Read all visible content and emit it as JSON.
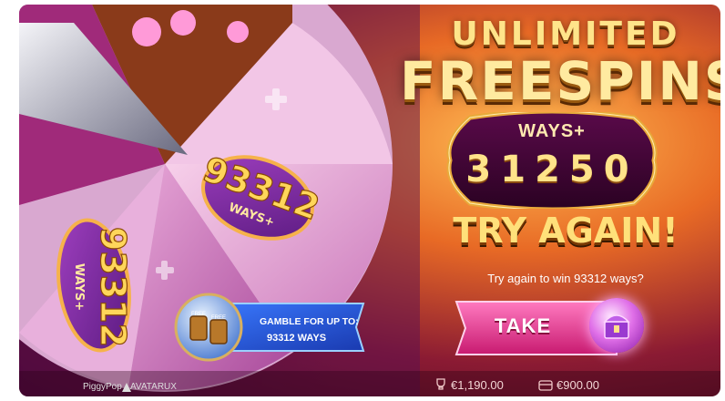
{
  "header": {
    "title_top": "UNLIMITED",
    "title_main": "FREESPINS"
  },
  "ways_panel": {
    "label": "WAYS+",
    "value": "31250"
  },
  "result": {
    "headline": "TRY AGAIN!",
    "message": "Try again to win 93312 ways?"
  },
  "wheel": {
    "slices": [
      {
        "ways": "93312",
        "label": "WAYS+"
      },
      {
        "ways": "93312",
        "label": "WAYS+"
      }
    ]
  },
  "gamble": {
    "line1": "GAMBLE FOR UP TO:",
    "line2": "93312 WAYS",
    "token_label": "FREE"
  },
  "take": {
    "label": "TAKE"
  },
  "footer": {
    "brand": "PiggyPop",
    "provider": "AVATARUX",
    "win_icon": "trophy-icon",
    "balance_win": "€1,190.00",
    "bank_icon": "wallet-icon",
    "balance_bank": "€900.00"
  },
  "colors": {
    "gold": "#ffe07a",
    "pink": "#e8389a",
    "purple": "#7a2aa0",
    "blue": "#2a5ae0"
  }
}
